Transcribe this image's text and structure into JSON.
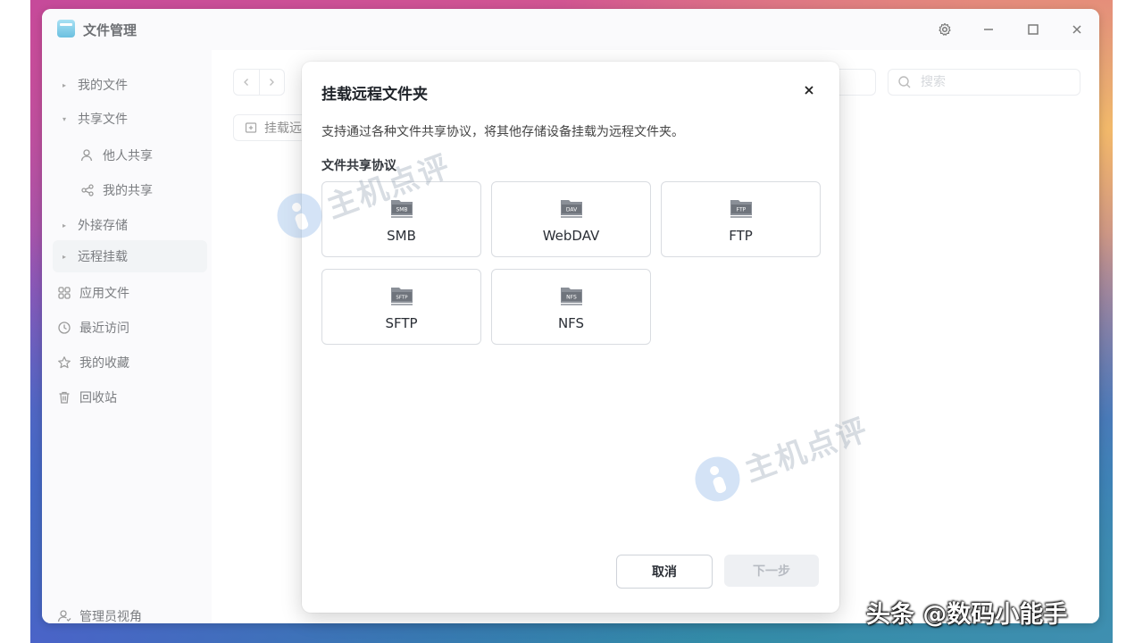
{
  "app": {
    "title": "文件管理"
  },
  "sidebar": {
    "items": [
      {
        "label": "我的文件",
        "icon": "caret-right-icon"
      },
      {
        "label": "共享文件",
        "icon": "caret-down-icon"
      },
      {
        "label": "他人共享",
        "icon": "users-icon"
      },
      {
        "label": "我的共享",
        "icon": "share-icon"
      },
      {
        "label": "外接存储",
        "icon": "caret-right-icon"
      },
      {
        "label": "远程挂载",
        "icon": "caret-right-icon",
        "active": true
      },
      {
        "label": "应用文件",
        "icon": "grid-icon"
      },
      {
        "label": "最近访问",
        "icon": "clock-icon"
      },
      {
        "label": "我的收藏",
        "icon": "star-icon"
      },
      {
        "label": "回收站",
        "icon": "trash-icon"
      }
    ],
    "footer": {
      "label": "管理员视角",
      "icon": "user-icon"
    }
  },
  "toolbar": {
    "search_placeholder": "搜索",
    "mount_label": "挂载远"
  },
  "dialog": {
    "title": "挂载远程文件夹",
    "description": "支持通过各种文件共享协议，将其他存储设备挂载为远程文件夹。",
    "section": "文件共享协议",
    "protocols": [
      {
        "label": "SMB",
        "badge": "SMB"
      },
      {
        "label": "WebDAV",
        "badge": "DAV"
      },
      {
        "label": "FTP",
        "badge": "FTP"
      },
      {
        "label": "SFTP",
        "badge": "SFTP"
      },
      {
        "label": "NFS",
        "badge": "NFS"
      }
    ],
    "cancel_label": "取消",
    "next_label": "下一步"
  },
  "watermarks": {
    "site": "主机点评",
    "corner": "头条 @数码小能手"
  },
  "colors": {
    "accent": "#1d9fd0",
    "disabled_text": "#b7bbc2"
  }
}
